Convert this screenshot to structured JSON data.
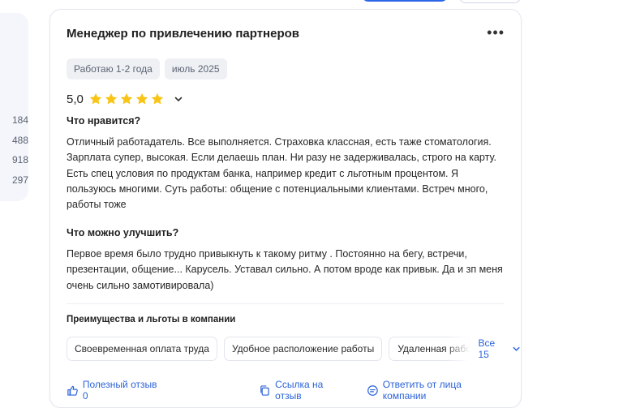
{
  "left_panel": {
    "numbers": [
      "184",
      "488",
      "918",
      "297"
    ]
  },
  "review": {
    "title": "Менеджер по привлечению партнеров",
    "more_label": "•••",
    "tags": [
      "Работаю 1-2 года",
      "июль 2025"
    ],
    "rating": {
      "value": "5,0",
      "stars": 5,
      "star_color": "#f8c416"
    },
    "likes_header": "Что нравится?",
    "likes_text": "Отличный работадатель. Все выполняется. Страховка классная, есть таже стоматология. Зарплата супер, высокая. Если делаешь план. Ни разу не задерживалась, строго на карту. Есть спец условия по продуктам банка, например кредит с льготным процентом. Я пользуюсь многими. Суть работы: общение с потенциальными клиентами. Встреч много, работы тоже",
    "improve_header": "Что можно улучшить?",
    "improve_text": "Первое время было трудно привыкнуть к такому ритму . Постоянно на бегу, встречи, презентации, общение... Карусель. Уставал сильно. А потом вроде как привык. Да и зп меня очень сильно замотивировала)",
    "benefits_header": "Преимущества и льготы в компании",
    "benefits": [
      "Своевременная оплата труда",
      "Удобное расположение работы",
      "Удаленная работа"
    ],
    "benefits_all_label": "Все 15",
    "footer": {
      "helpful_label": "Полезный отзыв 0",
      "link_label": "Ссылка на отзыв",
      "reply_label": "Ответить от лица компании"
    },
    "accent_color": "#2b63d9"
  }
}
